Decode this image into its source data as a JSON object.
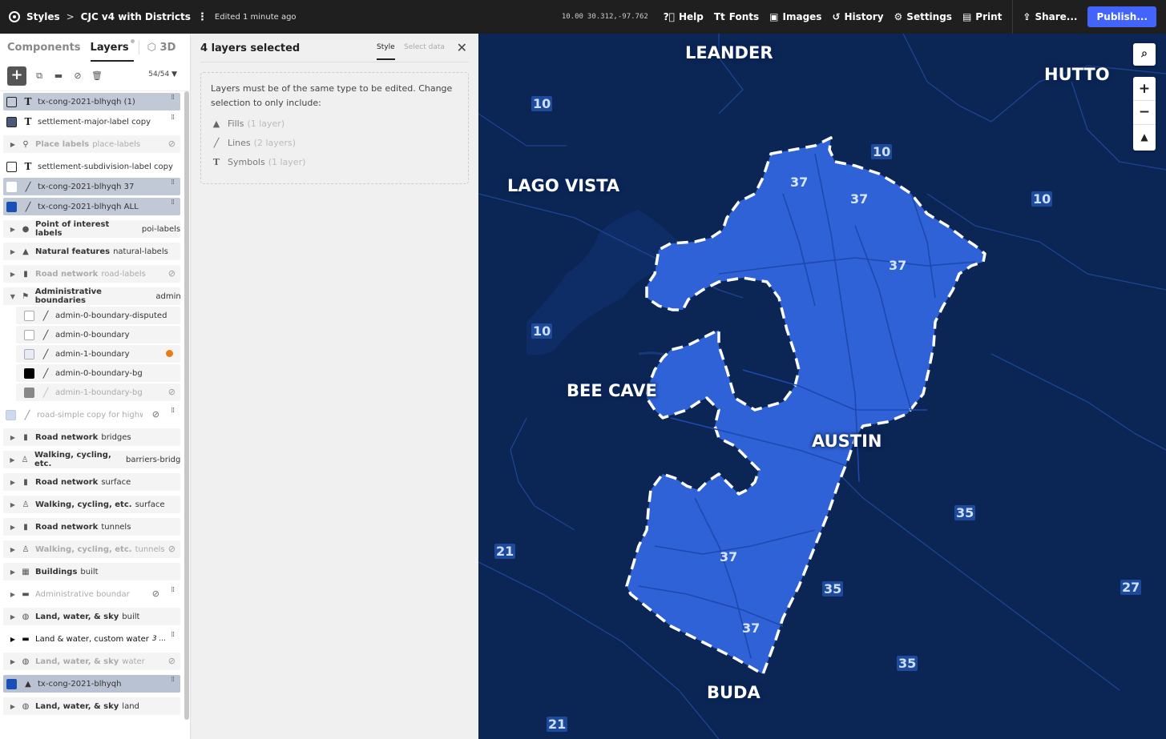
{
  "topbar": {
    "styles_label": "Styles",
    "title": "CJC v4 with Districts",
    "edited": "Edited 1 minute ago",
    "zoom": "10.00",
    "coords": "30.312,-97.762",
    "help": "Help",
    "fonts": "Fonts",
    "images": "Images",
    "history": "History",
    "settings": "Settings",
    "print": "Print",
    "share": "Share...",
    "publish": "Publish..."
  },
  "left": {
    "tab_components": "Components",
    "tab_layers": "Layers",
    "tab_3d": "3D",
    "count": "54/54",
    "rows": [
      {
        "label": "tx-cong-2021-blhyqh (1)"
      },
      {
        "label": "settlement-major-label copy"
      },
      {
        "bold": "Place labels",
        "label": "place-labels"
      },
      {
        "label": "settlement-subdivision-label copy"
      },
      {
        "label": "tx-cong-2021-blhyqh 37"
      },
      {
        "label": "tx-cong-2021-blhyqh ALL"
      },
      {
        "bold": "Point of interest labels",
        "label": "poi-labels"
      },
      {
        "bold": "Natural features",
        "label": "natural-labels"
      },
      {
        "bold": "Road network",
        "label": "road-labels"
      },
      {
        "bold": "Administrative boundaries",
        "label": "admin"
      },
      {
        "label": "admin-0-boundary-disputed"
      },
      {
        "label": "admin-0-boundary"
      },
      {
        "label": "admin-1-boundary"
      },
      {
        "label": "admin-0-boundary-bg"
      },
      {
        "label": "admin-1-boundary-bg"
      },
      {
        "label": "road-simple copy for highwa..."
      },
      {
        "bold": "Road network",
        "label": "bridges"
      },
      {
        "bold": "Walking, cycling, etc.",
        "label": "barriers-bridge"
      },
      {
        "bold": "Road network",
        "label": "surface"
      },
      {
        "bold": "Walking, cycling, etc.",
        "label": "surface"
      },
      {
        "bold": "Road network",
        "label": "tunnels"
      },
      {
        "bold": "Walking, cycling, etc.",
        "label": "tunnels"
      },
      {
        "bold": "Buildings",
        "label": "built"
      },
      {
        "label": "Administrative boundaries, ..."
      },
      {
        "bold": "Land, water, & sky",
        "label": "built"
      },
      {
        "label": "Land & water, custom water",
        "extra": "3 ..."
      },
      {
        "bold": "Land, water, & sky",
        "label": "water"
      },
      {
        "label": "tx-cong-2021-blhyqh"
      },
      {
        "bold": "Land, water, & sky",
        "label": "land"
      }
    ]
  },
  "middle": {
    "title": "4 layers selected",
    "tab_style": "Style",
    "tab_select": "Select data",
    "message": "Layers must be of the same type to be edited. Change selection to only include:",
    "options": [
      {
        "name": "Fills",
        "count": "(1 layer)"
      },
      {
        "name": "Lines",
        "count": "(2 layers)"
      },
      {
        "name": "Symbols",
        "count": "(1 layer)"
      }
    ]
  },
  "map": {
    "cities": [
      "LEANDER",
      "HUTTO",
      "LAGO VISTA",
      "BEE CAVE",
      "AUSTIN",
      "BUDA"
    ],
    "shields": [
      "10",
      "10",
      "10",
      "10",
      "37",
      "37",
      "37",
      "37",
      "37",
      "35",
      "35",
      "35",
      "21",
      "21",
      "27"
    ],
    "colors": {
      "water": "#0b2555",
      "district": "#2f62d6",
      "boundary": "#ffffff"
    }
  }
}
